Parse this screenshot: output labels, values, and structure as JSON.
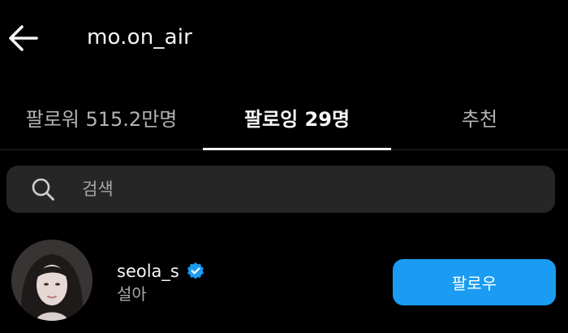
{
  "header": {
    "title": "mo.on_air",
    "back_icon": "arrow-left-icon"
  },
  "tabs": [
    {
      "label": "팔로워 515.2만명",
      "active": false
    },
    {
      "label": "팔로잉 29명",
      "active": true
    },
    {
      "label": "추천",
      "active": false
    }
  ],
  "search": {
    "placeholder": "검색",
    "icon": "search-icon"
  },
  "following": [
    {
      "username": "seola_s",
      "full_name": "설아",
      "verified": true,
      "follow_label": "팔로우"
    }
  ],
  "colors": {
    "background": "#000000",
    "search_bg": "#262626",
    "accent": "#1a9cf2",
    "verified": "#1a9cf2",
    "muted_text": "#a8a8a8"
  }
}
